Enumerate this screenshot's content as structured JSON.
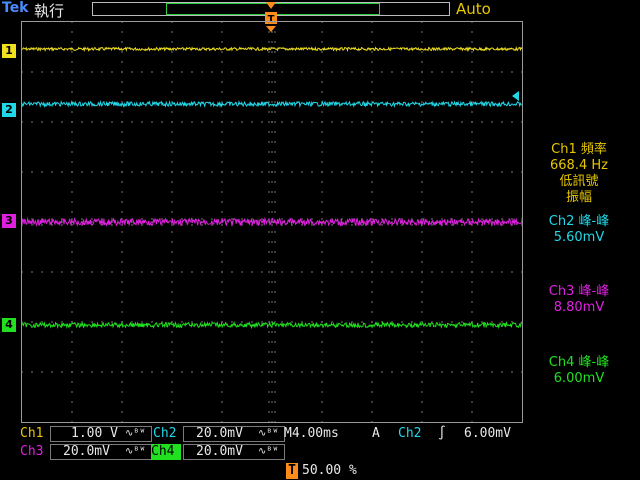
{
  "header": {
    "logo": "Tek",
    "run_state": "執行",
    "trigger_mode": "Auto"
  },
  "colors": {
    "ch1": "#f0e020",
    "ch2": "#20d8e8",
    "ch3": "#e020e0",
    "ch4": "#20e020",
    "trigger": "#ff8c1a",
    "grid": "#7a7a7a"
  },
  "channel_markers": {
    "ch1": "1",
    "ch2": "2",
    "ch3": "3",
    "ch4": "4"
  },
  "measurements": {
    "ch1": {
      "title": "Ch1 頻率",
      "value": "668.4 Hz",
      "note1": "低訊號",
      "note2": "振幅"
    },
    "ch2": {
      "title": "Ch2 峰-峰",
      "value": "5.60mV"
    },
    "ch3": {
      "title": "Ch3 峰-峰",
      "value": "8.80mV"
    },
    "ch4": {
      "title": "Ch4 峰-峰",
      "value": "6.00mV"
    }
  },
  "status": {
    "ch1_label": "Ch1",
    "ch1_scale": "1.00 V",
    "ch2_label": "Ch2",
    "ch2_scale": "20.0mV",
    "ch3_label": "Ch3",
    "ch3_scale": "20.0mV",
    "ch4_label": "Ch4",
    "ch4_scale": "20.0mV",
    "bw_symbol": "ᴮᵂ",
    "timebase": "M4.00ms",
    "trigger_type": "A",
    "trigger_source": "Ch2",
    "trigger_slope": "∫",
    "trigger_level": "6.00mV",
    "trigger_pos_marker": "T",
    "trigger_position": "50.00 %"
  }
}
